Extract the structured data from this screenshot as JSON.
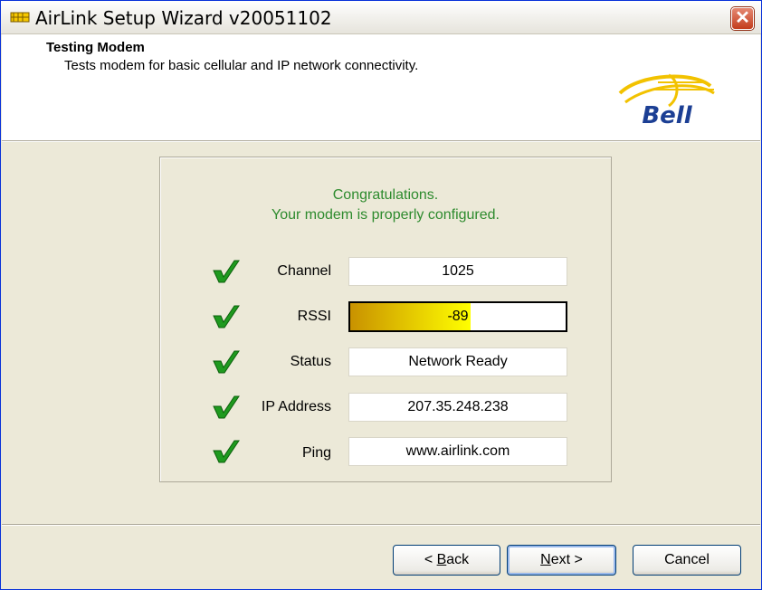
{
  "window": {
    "title": "AirLink Setup Wizard v20051102",
    "close_label": "✕"
  },
  "header": {
    "title": "Testing Modem",
    "subtitle": "Tests modem for basic cellular and IP network connectivity.",
    "logo_text": "Bell"
  },
  "status": {
    "line1": "Congratulations.",
    "line2": "Your modem is properly configured."
  },
  "results": [
    {
      "label": "Channel",
      "value": "1025"
    },
    {
      "label": "RSSI",
      "value": "-89",
      "signal_fill": 0.56
    },
    {
      "label": "Status",
      "value": "Network Ready"
    },
    {
      "label": "IP Address",
      "value": "207.35.248.238"
    },
    {
      "label": "Ping",
      "value": "www.airlink.com"
    }
  ],
  "buttons": {
    "back_mnemonic": "B",
    "back_rest": "ack",
    "back_prefix": "< ",
    "next_mnemonic": "N",
    "next_rest": "ext >",
    "cancel": "Cancel"
  },
  "colors": {
    "accent_green": "#2e8b2e",
    "check_green": "#1f9a1f",
    "logo_yellow": "#f2c200",
    "logo_blue": "#1c3f94"
  }
}
